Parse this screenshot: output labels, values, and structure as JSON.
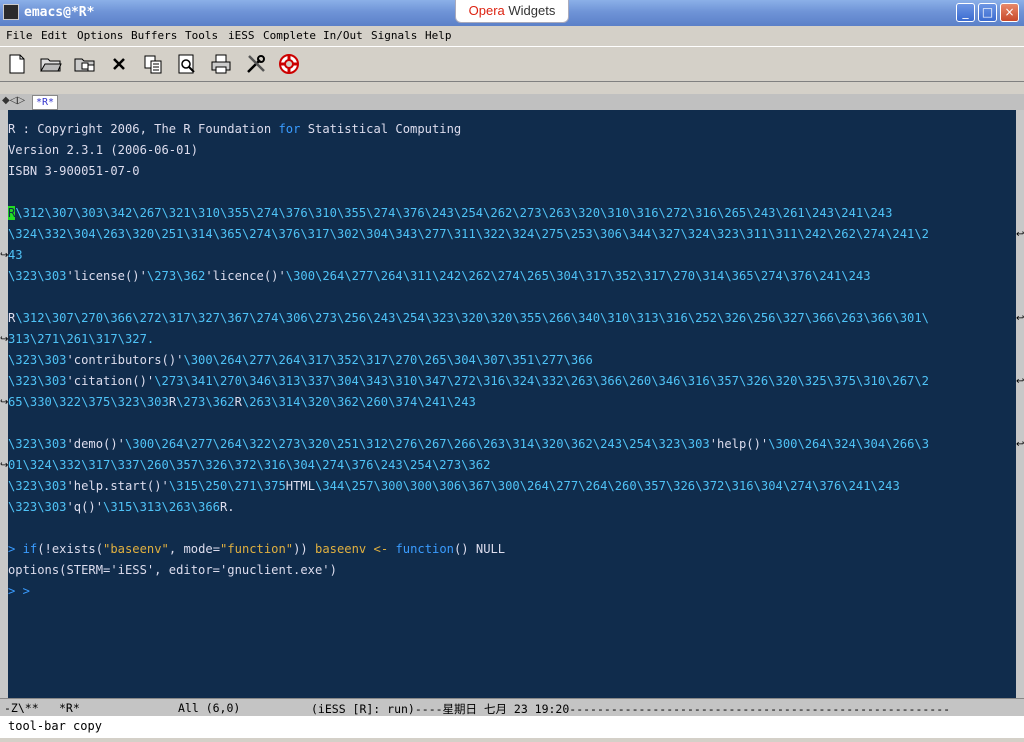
{
  "window": {
    "title": "emacs@*R*",
    "opera_widgets": [
      "Opera",
      "Widgets"
    ],
    "controls": [
      "_",
      "□",
      "×"
    ]
  },
  "menu": [
    "File",
    "Edit",
    "Options",
    "Buffers",
    "Tools",
    "iESS",
    "Complete",
    "In/Out",
    "Signals",
    "Help"
  ],
  "toolbar_icons": [
    "new-file-icon",
    "open-folder-icon",
    "open-dired-icon",
    "close-x-icon",
    "copy-icon",
    "find-icon",
    "print-icon",
    "customize-tools-icon",
    "help-lifebuoy-icon"
  ],
  "tabline": {
    "tab": "*R*"
  },
  "buffer": {
    "lines": [
      {
        "row": 1,
        "segments": [
          [
            "R : Copyright 2006, The R Foundation ",
            ""
          ],
          [
            "for",
            "kw"
          ],
          [
            " Statistical Computing",
            ""
          ]
        ]
      },
      {
        "row": 2,
        "segments": [
          [
            "Version 2.3.1 (2006-06-01)",
            ""
          ]
        ]
      },
      {
        "row": 3,
        "segments": [
          [
            "ISBN 3-900051-07-0",
            ""
          ]
        ]
      },
      {
        "row": 5,
        "segments": [
          [
            "R",
            "cursor"
          ],
          [
            "\\312\\307\\303\\342\\267\\321\\310\\355\\274\\376\\310\\355\\274\\376\\243\\254\\262\\273\\263\\320\\310\\316\\272\\316\\265\\243\\261\\243\\241\\243",
            "esc"
          ]
        ]
      },
      {
        "row": 6,
        "segments": [
          [
            "\\324\\332\\304\\263\\320\\251\\314\\365\\274\\376\\317\\302\\304\\343\\277\\311\\322\\324\\275\\253\\306\\344\\327\\324\\323\\311\\311\\242\\262\\274\\241\\2",
            "esc"
          ]
        ],
        "wrap": true
      },
      {
        "row": 7,
        "segments": [
          [
            "43",
            "esc"
          ]
        ]
      },
      {
        "row": 8,
        "segments": [
          [
            "\\323\\303",
            "esc"
          ],
          [
            "'license()'",
            ""
          ],
          [
            "\\273\\362",
            "esc"
          ],
          [
            "'licence()'",
            ""
          ],
          [
            "\\300\\264\\277\\264\\311\\242\\262\\274\\265\\304\\317\\352\\317\\270\\314\\365\\274\\376\\241\\243",
            "esc"
          ]
        ]
      },
      {
        "row": 10,
        "segments": [
          [
            "R",
            ""
          ],
          [
            "\\312\\307\\270\\366\\272\\317\\327\\367\\274\\306\\273\\256\\243\\254\\323\\320\\320\\355\\266\\340\\310\\313\\316\\252\\326\\256\\327\\366\\263\\366\\301\\",
            "esc"
          ]
        ],
        "wrap": true
      },
      {
        "row": 11,
        "segments": [
          [
            "313\\271\\261\\317\\327.",
            "esc"
          ]
        ]
      },
      {
        "row": 12,
        "segments": [
          [
            "\\323\\303",
            "esc"
          ],
          [
            "'contributors()'",
            ""
          ],
          [
            "\\300\\264\\277\\264\\317\\352\\317\\270\\265\\304\\307\\351\\277\\366",
            "esc"
          ]
        ]
      },
      {
        "row": 13,
        "segments": [
          [
            "\\323\\303",
            "esc"
          ],
          [
            "'citation()'",
            ""
          ],
          [
            "\\273\\341\\270\\346\\313\\337\\304\\343\\310\\347\\272\\316\\324\\332\\263\\366\\260\\346\\316\\357\\326\\320\\325\\375\\310\\267\\2",
            "esc"
          ]
        ],
        "wrap": true
      },
      {
        "row": 14,
        "segments": [
          [
            "65\\330\\322\\375\\323\\303",
            "esc"
          ],
          [
            "R",
            ""
          ],
          [
            "\\273\\362",
            "esc"
          ],
          [
            "R",
            ""
          ],
          [
            "\\263\\314\\320\\362\\260\\374\\241\\243",
            "esc"
          ]
        ]
      },
      {
        "row": 16,
        "segments": [
          [
            "\\323\\303",
            "esc"
          ],
          [
            "'demo()'",
            ""
          ],
          [
            "\\300\\264\\277\\264\\322\\273\\320\\251\\312\\276\\267\\266\\263\\314\\320\\362\\243\\254\\323\\303",
            "esc"
          ],
          [
            "'help()'",
            ""
          ],
          [
            "\\300\\264\\324\\304\\266\\3",
            "esc"
          ]
        ],
        "wrap": true
      },
      {
        "row": 17,
        "segments": [
          [
            "01\\324\\332\\317\\337\\260\\357\\326\\372\\316\\304\\274\\376\\243\\254\\273\\362",
            "esc"
          ]
        ]
      },
      {
        "row": 18,
        "segments": [
          [
            "\\323\\303",
            "esc"
          ],
          [
            "'help.start()'",
            ""
          ],
          [
            "\\315\\250\\271\\375",
            "esc"
          ],
          [
            "HTML",
            ""
          ],
          [
            "\\344\\257\\300\\300\\306\\367\\300\\264\\277\\264\\260\\357\\326\\372\\316\\304\\274\\376\\241\\243",
            "esc"
          ]
        ]
      },
      {
        "row": 19,
        "segments": [
          [
            "\\323\\303",
            "esc"
          ],
          [
            "'q()'",
            ""
          ],
          [
            "\\315\\313\\263\\366",
            "esc"
          ],
          [
            "R.",
            ""
          ]
        ]
      },
      {
        "row": 21,
        "segments": [
          [
            "> ",
            "prompt"
          ],
          [
            "if",
            "kw"
          ],
          [
            "(!exists(",
            ""
          ],
          [
            "\"baseenv\"",
            "str"
          ],
          [
            ", mode=",
            ""
          ],
          [
            "\"function\"",
            "str"
          ],
          [
            ")) ",
            ""
          ],
          [
            "baseenv",
            "fn"
          ],
          [
            " ",
            ""
          ],
          [
            "<-",
            "fn"
          ],
          [
            " ",
            ""
          ],
          [
            "function",
            "kw"
          ],
          [
            "() NULL",
            ""
          ]
        ]
      },
      {
        "row": 22,
        "segments": [
          [
            "options(STERM='iESS', editor='gnuclient.exe')",
            ""
          ]
        ]
      },
      {
        "row": 23,
        "segments": [
          [
            "> >",
            "prompt"
          ]
        ]
      }
    ]
  },
  "modeline": {
    "status": "-Z\\**",
    "buffer_name": "*R*",
    "position": "All (6,0)",
    "mode": "(iESS [R]: run)----星期日 七月 23 19:20-------------------------------------------------------"
  },
  "minibuffer": {
    "text": "tool-bar copy"
  }
}
